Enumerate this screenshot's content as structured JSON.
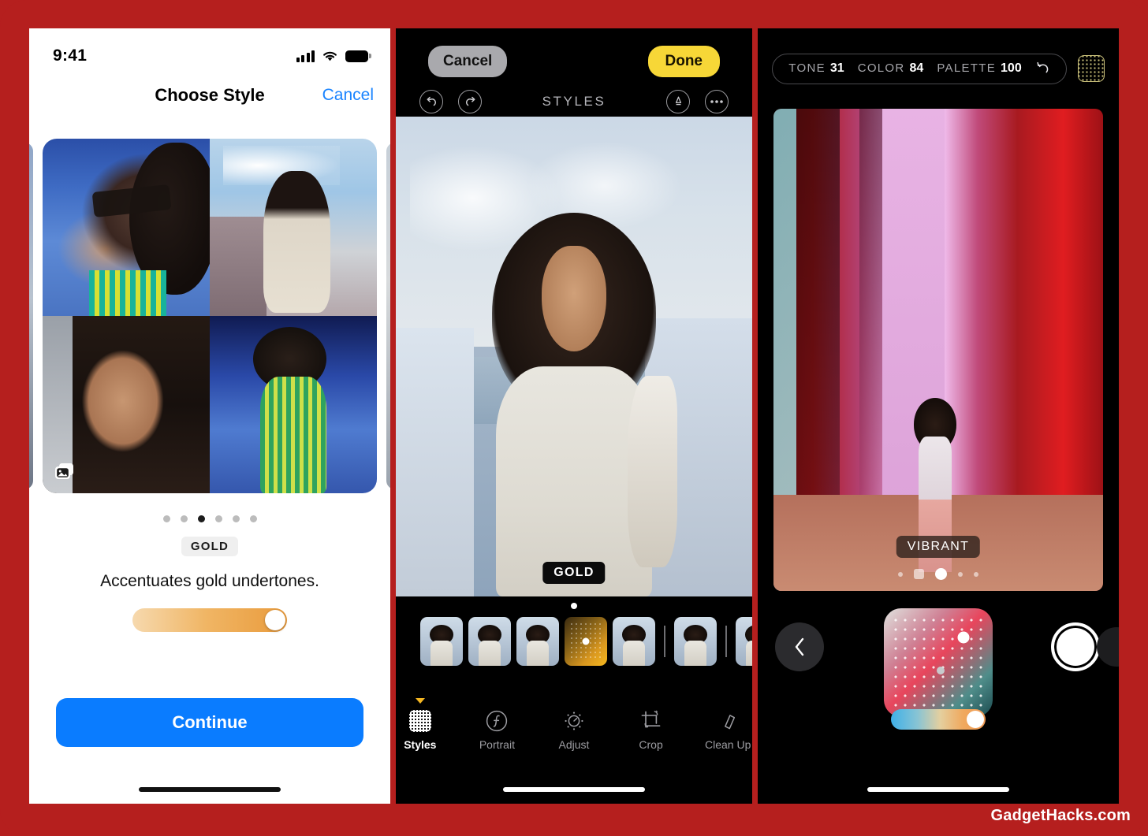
{
  "watermark": "GadgetHacks.com",
  "frame_color": "#B51F1E",
  "panel1": {
    "status": {
      "time": "9:41",
      "signal_icon": "cellular-signal-icon",
      "wifi_icon": "wifi-icon",
      "battery_icon": "battery-icon"
    },
    "nav": {
      "title": "Choose Style",
      "cancel_label": "Cancel"
    },
    "carousel": {
      "stack_icon": "photo-stack-icon",
      "dots_total": 6,
      "dots_active_index": 2,
      "tiles": [
        {
          "name": "portrait-sunglasses-blue-wall"
        },
        {
          "name": "portrait-sky-white-top"
        },
        {
          "name": "portrait-closeup-face"
        },
        {
          "name": "portrait-green-striped-dress"
        }
      ]
    },
    "style": {
      "pill_label": "GOLD",
      "description": "Accentuates gold undertones.",
      "slider_value": 88,
      "slider_accent": "#E99B3C"
    },
    "continue_label": "Continue",
    "continue_color": "#0A7CFF"
  },
  "panel2": {
    "top": {
      "cancel_label": "Cancel",
      "done_label": "Done",
      "done_color": "#F7D737",
      "title": "STYLES",
      "undo_icon": "undo-icon",
      "redo_icon": "redo-icon",
      "markup_icon": "markup-pen-icon",
      "more_icon": "more-options-icon"
    },
    "photo": {
      "name": "portrait-woman-white-wall-sea",
      "style_badge": "GOLD"
    },
    "filmstrip": {
      "selected_index": 3,
      "items": [
        {
          "name": "style-thumbnail",
          "type": "photo"
        },
        {
          "name": "style-thumbnail",
          "type": "photo"
        },
        {
          "name": "style-thumbnail",
          "type": "photo"
        },
        {
          "name": "style-swatch-gold",
          "type": "swatch"
        },
        {
          "name": "style-thumbnail",
          "type": "photo"
        },
        {
          "name": "style-thumbnail",
          "type": "photo"
        }
      ]
    },
    "tabs": [
      {
        "label": "Styles",
        "icon": "styles-grid-icon",
        "active": true
      },
      {
        "label": "Portrait",
        "icon": "portrait-f-icon",
        "active": false
      },
      {
        "label": "Adjust",
        "icon": "adjust-dial-icon",
        "active": false
      },
      {
        "label": "Crop",
        "icon": "crop-icon",
        "active": false
      },
      {
        "label": "Clean Up",
        "icon": "clean-up-eraser-icon",
        "active": false
      }
    ]
  },
  "panel3": {
    "params": [
      {
        "label": "TONE",
        "value": "31"
      },
      {
        "label": "COLOR",
        "value": "84"
      },
      {
        "label": "PALETTE",
        "value": "100"
      }
    ],
    "reset_icon": "reset-arrow-icon",
    "grid_button_icon": "styles-grid-icon",
    "grid_button_color": "#C9C07A",
    "photo": {
      "name": "portrait-woman-pink-red-architecture",
      "style_badge": "VIBRANT"
    },
    "page_dots": {
      "total": 5,
      "active_index": 2
    },
    "controls": {
      "back_icon": "chevron-left-icon",
      "shutter_icon": "shutter-button",
      "color_pad_icon": "color-palette-pad",
      "temp_slider_value": 90
    }
  }
}
